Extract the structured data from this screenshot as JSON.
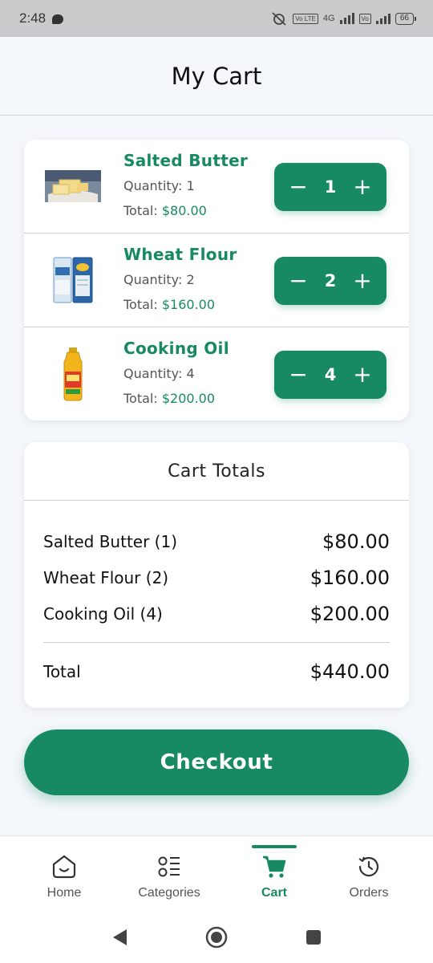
{
  "status_bar": {
    "time": "2:48",
    "battery": "66",
    "network": "4G",
    "sim_tag": "Vo LTE"
  },
  "page": {
    "title": "My Cart"
  },
  "cart": {
    "items": [
      {
        "name": "Salted Butter",
        "quantity_text": "Quantity: 1",
        "total_label": "Total: ",
        "total_value": "$80.00",
        "count": "1",
        "image": "butter-image"
      },
      {
        "name": "Wheat Flour",
        "quantity_text": "Quantity: 2",
        "total_label": "Total: ",
        "total_value": "$160.00",
        "count": "2",
        "image": "flour-bag-image"
      },
      {
        "name": "Cooking Oil",
        "quantity_text": "Quantity: 4",
        "total_label": "Total: ",
        "total_value": "$200.00",
        "count": "4",
        "image": "oil-bottle-image"
      }
    ],
    "stepper": {
      "minus": "−",
      "plus": "+"
    }
  },
  "totals": {
    "title": "Cart Totals",
    "rows": [
      {
        "label": "Salted Butter (1)",
        "value": "$80.00"
      },
      {
        "label": "Wheat Flour (2)",
        "value": "$160.00"
      },
      {
        "label": "Cooking Oil (4)",
        "value": "$200.00"
      }
    ],
    "total_label": "Total",
    "total_value": "$440.00"
  },
  "checkout": {
    "label": "Checkout"
  },
  "nav": {
    "items": [
      {
        "label": "Home",
        "icon": "home-icon"
      },
      {
        "label": "Categories",
        "icon": "categories-icon"
      },
      {
        "label": "Cart",
        "icon": "cart-icon",
        "active": true
      },
      {
        "label": "Orders",
        "icon": "history-icon"
      }
    ]
  },
  "colors": {
    "accent": "#178a63",
    "background": "#f4f7fb",
    "card": "#ffffff"
  }
}
